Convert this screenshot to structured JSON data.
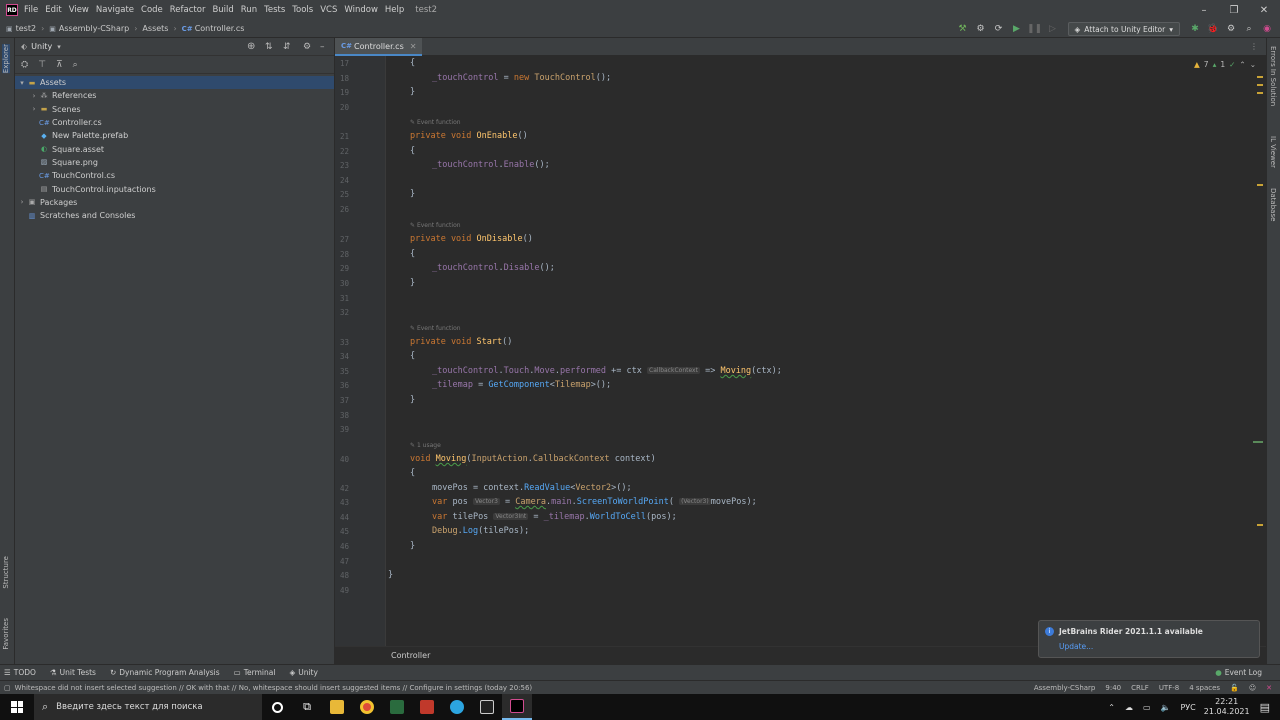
{
  "menu": {
    "items": [
      "File",
      "Edit",
      "View",
      "Navigate",
      "Code",
      "Refactor",
      "Build",
      "Run",
      "Tests",
      "Tools",
      "VCS",
      "Window",
      "Help"
    ],
    "window_title": "test2"
  },
  "nav": {
    "crumbs": [
      "test2",
      "Assembly-CSharp",
      "Assets",
      "Controller.cs"
    ],
    "attach_label": "Attach to Unity Editor"
  },
  "project": {
    "title": "Unity",
    "tree": [
      {
        "label": "Assets",
        "type": "folder",
        "depth": 0,
        "expanded": true,
        "selected": true
      },
      {
        "label": "References",
        "type": "refs",
        "depth": 1,
        "expanded": false
      },
      {
        "label": "Scenes",
        "type": "folder",
        "depth": 1,
        "expanded": false
      },
      {
        "label": "Controller.cs",
        "type": "cs",
        "depth": 1
      },
      {
        "label": "New Palette.prefab",
        "type": "prefab",
        "depth": 1
      },
      {
        "label": "Square.asset",
        "type": "asset",
        "depth": 1
      },
      {
        "label": "Square.png",
        "type": "png",
        "depth": 1
      },
      {
        "label": "TouchControl.cs",
        "type": "cs",
        "depth": 1
      },
      {
        "label": "TouchControl.inputactions",
        "type": "file",
        "depth": 1
      },
      {
        "label": "Packages",
        "type": "packages",
        "depth": 0,
        "expanded": false
      },
      {
        "label": "Scratches and Consoles",
        "type": "scratch",
        "depth": 0
      }
    ]
  },
  "left_stripe": {
    "explorer": "Explorer",
    "structure": "Structure",
    "favorites": "Favorites"
  },
  "right_stripe": {
    "errors": "Errors In Solution",
    "il": "IL Viewer",
    "database": "Database"
  },
  "editor": {
    "tab": "Controller.cs",
    "inspection": {
      "warnings": "7",
      "weak": "1"
    },
    "footer": "Controller",
    "hints": {
      "event": "Event function",
      "usage": "1 usage"
    },
    "lines": [
      "17",
      "18",
      "19",
      "20",
      "21",
      "22",
      "23",
      "24",
      "25",
      "26",
      "27",
      "28",
      "29",
      "30",
      "31",
      "32",
      "33",
      "34",
      "35",
      "36",
      "37",
      "38",
      "39",
      "40",
      "42",
      "43",
      "44",
      "45",
      "46",
      "47",
      "48",
      "49"
    ]
  },
  "bottom_tools": [
    "TODO",
    "Unit Tests",
    "Dynamic Program Analysis",
    "Terminal",
    "Unity"
  ],
  "event_log": "Event Log",
  "status": {
    "message": "Whitespace did not insert selected suggestion // OK with that // No, whitespace should insert suggested items // Configure in settings (today 20:56)",
    "project": "Assembly-CSharp",
    "position": "9:40",
    "line_sep": "CRLF",
    "encoding": "UTF-8",
    "indent": "4 spaces"
  },
  "notification": {
    "title": "JetBrains Rider 2021.1.1 available",
    "link": "Update..."
  },
  "taskbar": {
    "search_placeholder": "Введите здесь текст для поиска",
    "lang": "РУС",
    "time": "22:21",
    "date": "21.04.2021"
  }
}
